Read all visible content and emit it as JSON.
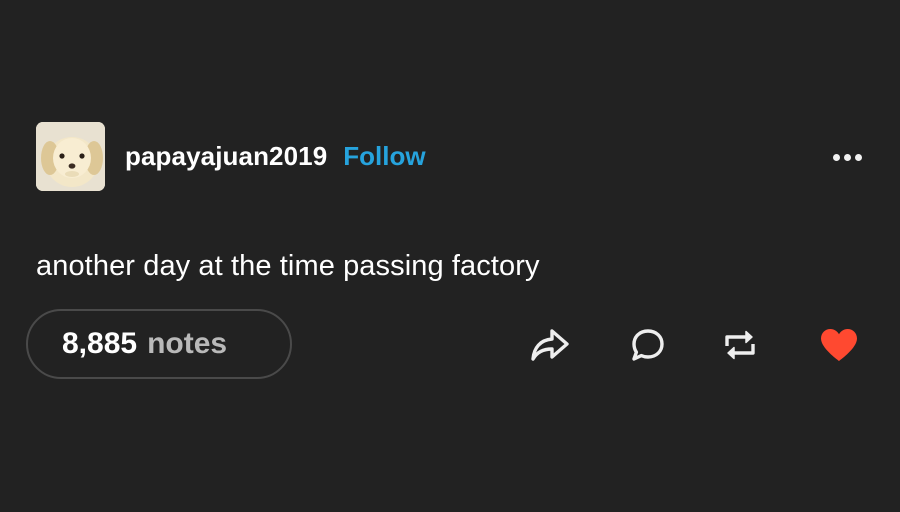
{
  "post": {
    "username": "papayajuan2019",
    "follow_label": "Follow",
    "text": "another day at the time passing factory",
    "notes_count": "8,885",
    "notes_label": "notes"
  },
  "icons": {
    "avatar": "puppy-avatar",
    "more": "more-options-icon",
    "share": "share-icon",
    "reply": "reply-icon",
    "reblog": "reblog-icon",
    "like": "heart-icon"
  },
  "colors": {
    "background": "#222222",
    "text": "#ffffff",
    "follow": "#26a3dd",
    "notes_label": "#b9b9b9",
    "pill_border": "#4a4a4a",
    "like": "#ff4930"
  }
}
